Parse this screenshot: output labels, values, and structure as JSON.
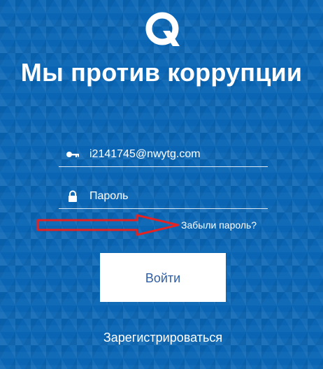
{
  "logo": {
    "icon": "q-logo-icon"
  },
  "headline": "Мы против коррупции",
  "form": {
    "email": {
      "value": "i2141745@nwytg.com",
      "icon": "key-icon"
    },
    "password": {
      "placeholder": "Пароль",
      "icon": "lock-icon"
    },
    "forgot_label": "Забыли пароль?",
    "login_label": "Войти",
    "register_label": "Зарегистрироваться"
  },
  "colors": {
    "background": "#0a66b5",
    "button_text": "#2f5ea6",
    "annotation_arrow": "#e52222"
  }
}
